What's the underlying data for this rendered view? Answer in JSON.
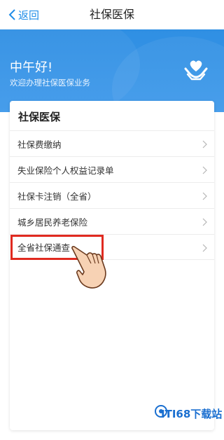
{
  "nav": {
    "back_label": "返回",
    "title": "社保医保"
  },
  "hero": {
    "greeting": "中午好!",
    "welcome": "欢迎办理社保医保业务",
    "icon": "heart-hands-icon"
  },
  "card": {
    "title": "社保医保",
    "items": [
      {
        "label": "社保费缴纳"
      },
      {
        "label": "失业保险个人权益记录单"
      },
      {
        "label": "社保卡注销（全省）"
      },
      {
        "label": "城乡居民养老保险"
      },
      {
        "label": "全省社保通查"
      }
    ]
  },
  "watermark": {
    "text": "ITI68下载站"
  },
  "colors": {
    "accent": "#1f8de8",
    "banner": "#2f8fe3",
    "highlight": "#e02a20"
  }
}
